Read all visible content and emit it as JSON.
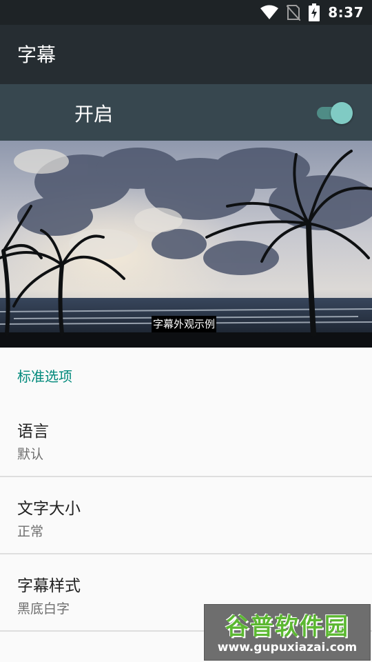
{
  "status_bar": {
    "time": "8:37",
    "icons": [
      "wifi-icon",
      "no-sim-icon",
      "battery-charging-icon"
    ]
  },
  "app_bar": {
    "title": "字幕"
  },
  "master_switch": {
    "label": "开启",
    "state": "on"
  },
  "preview": {
    "caption_sample": "字幕外观示例"
  },
  "sections": [
    {
      "header": "标准选项",
      "items": [
        {
          "title": "语言",
          "summary": "默认"
        },
        {
          "title": "文字大小",
          "summary": "正常"
        },
        {
          "title": "字幕样式",
          "summary": "黑底白字"
        }
      ]
    }
  ],
  "watermark": {
    "title": "谷普软件园",
    "url": "www.gupuxiazai.com"
  },
  "colors": {
    "accent": "#00897b",
    "app_bar": "#262d32",
    "switch_bar": "#37474f"
  }
}
